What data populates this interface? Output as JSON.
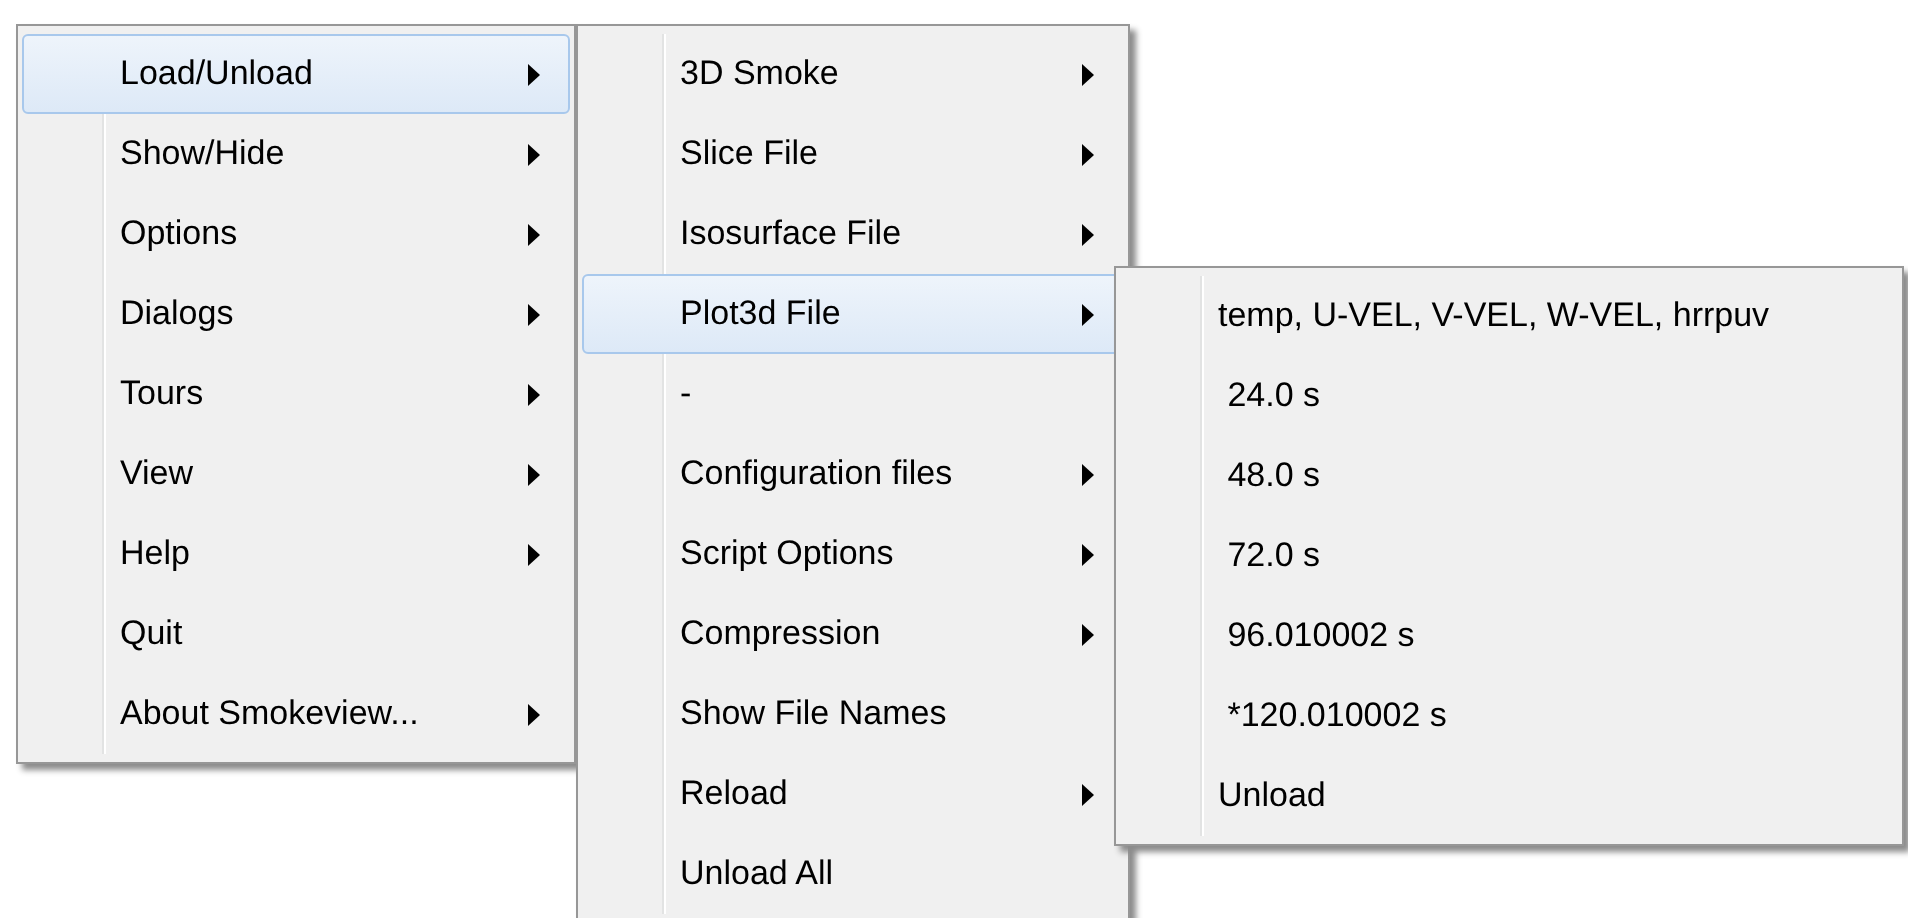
{
  "menus": [
    {
      "items": [
        {
          "label": "Load/Unload",
          "submenu": true,
          "selected": true
        },
        {
          "label": "Show/Hide",
          "submenu": true,
          "selected": false
        },
        {
          "label": "Options",
          "submenu": true,
          "selected": false
        },
        {
          "label": "Dialogs",
          "submenu": true,
          "selected": false
        },
        {
          "label": "Tours",
          "submenu": true,
          "selected": false
        },
        {
          "label": "View",
          "submenu": true,
          "selected": false
        },
        {
          "label": "Help",
          "submenu": true,
          "selected": false
        },
        {
          "label": "Quit",
          "submenu": false,
          "selected": false
        },
        {
          "label": "About Smokeview...",
          "submenu": true,
          "selected": false
        }
      ]
    },
    {
      "items": [
        {
          "label": "3D Smoke",
          "submenu": true,
          "selected": false
        },
        {
          "label": "Slice File",
          "submenu": true,
          "selected": false
        },
        {
          "label": "Isosurface File",
          "submenu": true,
          "selected": false
        },
        {
          "label": "Plot3d File",
          "submenu": true,
          "selected": true
        },
        {
          "label": "-",
          "submenu": false,
          "selected": false
        },
        {
          "label": "Configuration files",
          "submenu": true,
          "selected": false
        },
        {
          "label": "Script Options",
          "submenu": true,
          "selected": false
        },
        {
          "label": "Compression",
          "submenu": true,
          "selected": false
        },
        {
          "label": "Show File Names",
          "submenu": false,
          "selected": false
        },
        {
          "label": "Reload",
          "submenu": true,
          "selected": false
        },
        {
          "label": "Unload All",
          "submenu": false,
          "selected": false
        }
      ]
    },
    {
      "items": [
        {
          "label": "temp, U-VEL, V-VEL, W-VEL, hrrpuv",
          "submenu": false,
          "selected": false
        },
        {
          "label": " 24.0 s",
          "submenu": false,
          "selected": false
        },
        {
          "label": " 48.0 s",
          "submenu": false,
          "selected": false
        },
        {
          "label": " 72.0 s",
          "submenu": false,
          "selected": false
        },
        {
          "label": " 96.010002 s",
          "submenu": false,
          "selected": false
        },
        {
          "label": " *120.010002 s",
          "submenu": false,
          "selected": false
        },
        {
          "label": "Unload",
          "submenu": false,
          "selected": false
        }
      ]
    }
  ]
}
